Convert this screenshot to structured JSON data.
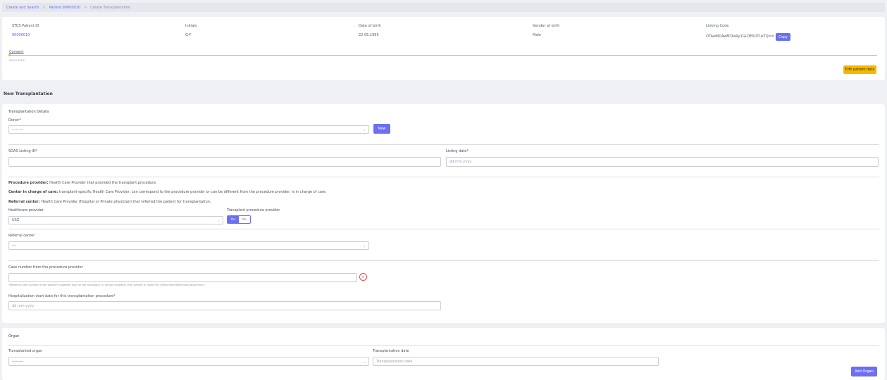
{
  "breadcrumb": {
    "items": [
      "Create and Search",
      "Patient 90000010",
      "Create Transplantation"
    ]
  },
  "patient": {
    "stcs_id_label": "STCS Patient ID",
    "stcs_id": "90000010",
    "initials_label": "Initials",
    "initials": "G-F",
    "dob_label": "Date of birth",
    "dob": "22.05.1995",
    "gender_label": "Gender at birth",
    "gender": "Male",
    "linking_label": "Linking Code",
    "linking_code": "OTAwMDAwMTAsRy1GLDE5OTUsTQ==",
    "copy_label": "Copy",
    "consent_label": "Consent",
    "consent_date": "03.03.2024",
    "edit_label": "Edit patient data"
  },
  "page_title": "New Transplantation",
  "details": {
    "title": "Transplantation Details",
    "donor_label": "Donor*",
    "donor_value": "---------",
    "new_label": "New",
    "soas_label": "SOAS Listing ID*",
    "listing_date_label": "Listing date*",
    "listing_date_placeholder": "dd.mm.yyyy",
    "info_procedure_term": "Procedure provider:",
    "info_procedure_text": "Health Care Provider that provided the transplant procedure.",
    "info_center_term": "Center in charge of care:",
    "info_center_text": "transplant-specific Health Care Provider, can correspond to the procedure provider or can be different from the procedure provider. Is in charge of care.",
    "info_referral_term": "Referral center:",
    "info_referral_text": "Health Care Provider (Hospital or Private physician) that referred the patient for transplantation.",
    "hcp_label": "Healthcare provider",
    "hcp_value": "USZ",
    "tpp_label": "Transplant procedure provider",
    "yes_label": "Yes",
    "no_label": "No",
    "referral_label": "Referral center",
    "referral_value": "---",
    "case_label": "Case number from the procedure provider",
    "case_hint": "Treatment case number of the patient's inpatient stay for the transplant. In certain hospitals, this number is called FID (Fallnummer/Behandlungsnummer).",
    "clear_symbol": "×",
    "hosp_label": "Hospitalization start date for this transplantation procedure*",
    "hosp_placeholder": "dd.mm.yyyy"
  },
  "organ": {
    "title": "Organ",
    "organ_label": "Transplanted organ",
    "organ_value": "---------",
    "tx_date_label": "Transplantation date",
    "tx_date_placeholder": "Transplantation date",
    "add_label": "Add Organ"
  },
  "icons": {
    "chevron": "⌄"
  },
  "colors": {
    "accent": "#6c6ff0",
    "warning": "#f5b800",
    "danger": "#e24b4b"
  }
}
